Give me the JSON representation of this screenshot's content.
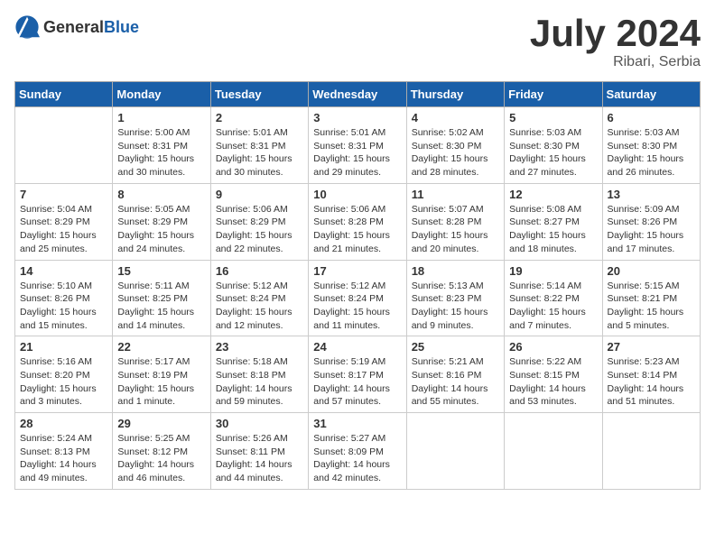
{
  "header": {
    "logo_general": "General",
    "logo_blue": "Blue",
    "month_year": "July 2024",
    "location": "Ribari, Serbia"
  },
  "weekdays": [
    "Sunday",
    "Monday",
    "Tuesday",
    "Wednesday",
    "Thursday",
    "Friday",
    "Saturday"
  ],
  "weeks": [
    [
      {
        "day": "",
        "info": ""
      },
      {
        "day": "1",
        "info": "Sunrise: 5:00 AM\nSunset: 8:31 PM\nDaylight: 15 hours\nand 30 minutes."
      },
      {
        "day": "2",
        "info": "Sunrise: 5:01 AM\nSunset: 8:31 PM\nDaylight: 15 hours\nand 30 minutes."
      },
      {
        "day": "3",
        "info": "Sunrise: 5:01 AM\nSunset: 8:31 PM\nDaylight: 15 hours\nand 29 minutes."
      },
      {
        "day": "4",
        "info": "Sunrise: 5:02 AM\nSunset: 8:30 PM\nDaylight: 15 hours\nand 28 minutes."
      },
      {
        "day": "5",
        "info": "Sunrise: 5:03 AM\nSunset: 8:30 PM\nDaylight: 15 hours\nand 27 minutes."
      },
      {
        "day": "6",
        "info": "Sunrise: 5:03 AM\nSunset: 8:30 PM\nDaylight: 15 hours\nand 26 minutes."
      }
    ],
    [
      {
        "day": "7",
        "info": "Sunrise: 5:04 AM\nSunset: 8:29 PM\nDaylight: 15 hours\nand 25 minutes."
      },
      {
        "day": "8",
        "info": "Sunrise: 5:05 AM\nSunset: 8:29 PM\nDaylight: 15 hours\nand 24 minutes."
      },
      {
        "day": "9",
        "info": "Sunrise: 5:06 AM\nSunset: 8:29 PM\nDaylight: 15 hours\nand 22 minutes."
      },
      {
        "day": "10",
        "info": "Sunrise: 5:06 AM\nSunset: 8:28 PM\nDaylight: 15 hours\nand 21 minutes."
      },
      {
        "day": "11",
        "info": "Sunrise: 5:07 AM\nSunset: 8:28 PM\nDaylight: 15 hours\nand 20 minutes."
      },
      {
        "day": "12",
        "info": "Sunrise: 5:08 AM\nSunset: 8:27 PM\nDaylight: 15 hours\nand 18 minutes."
      },
      {
        "day": "13",
        "info": "Sunrise: 5:09 AM\nSunset: 8:26 PM\nDaylight: 15 hours\nand 17 minutes."
      }
    ],
    [
      {
        "day": "14",
        "info": "Sunrise: 5:10 AM\nSunset: 8:26 PM\nDaylight: 15 hours\nand 15 minutes."
      },
      {
        "day": "15",
        "info": "Sunrise: 5:11 AM\nSunset: 8:25 PM\nDaylight: 15 hours\nand 14 minutes."
      },
      {
        "day": "16",
        "info": "Sunrise: 5:12 AM\nSunset: 8:24 PM\nDaylight: 15 hours\nand 12 minutes."
      },
      {
        "day": "17",
        "info": "Sunrise: 5:12 AM\nSunset: 8:24 PM\nDaylight: 15 hours\nand 11 minutes."
      },
      {
        "day": "18",
        "info": "Sunrise: 5:13 AM\nSunset: 8:23 PM\nDaylight: 15 hours\nand 9 minutes."
      },
      {
        "day": "19",
        "info": "Sunrise: 5:14 AM\nSunset: 8:22 PM\nDaylight: 15 hours\nand 7 minutes."
      },
      {
        "day": "20",
        "info": "Sunrise: 5:15 AM\nSunset: 8:21 PM\nDaylight: 15 hours\nand 5 minutes."
      }
    ],
    [
      {
        "day": "21",
        "info": "Sunrise: 5:16 AM\nSunset: 8:20 PM\nDaylight: 15 hours\nand 3 minutes."
      },
      {
        "day": "22",
        "info": "Sunrise: 5:17 AM\nSunset: 8:19 PM\nDaylight: 15 hours\nand 1 minute."
      },
      {
        "day": "23",
        "info": "Sunrise: 5:18 AM\nSunset: 8:18 PM\nDaylight: 14 hours\nand 59 minutes."
      },
      {
        "day": "24",
        "info": "Sunrise: 5:19 AM\nSunset: 8:17 PM\nDaylight: 14 hours\nand 57 minutes."
      },
      {
        "day": "25",
        "info": "Sunrise: 5:21 AM\nSunset: 8:16 PM\nDaylight: 14 hours\nand 55 minutes."
      },
      {
        "day": "26",
        "info": "Sunrise: 5:22 AM\nSunset: 8:15 PM\nDaylight: 14 hours\nand 53 minutes."
      },
      {
        "day": "27",
        "info": "Sunrise: 5:23 AM\nSunset: 8:14 PM\nDaylight: 14 hours\nand 51 minutes."
      }
    ],
    [
      {
        "day": "28",
        "info": "Sunrise: 5:24 AM\nSunset: 8:13 PM\nDaylight: 14 hours\nand 49 minutes."
      },
      {
        "day": "29",
        "info": "Sunrise: 5:25 AM\nSunset: 8:12 PM\nDaylight: 14 hours\nand 46 minutes."
      },
      {
        "day": "30",
        "info": "Sunrise: 5:26 AM\nSunset: 8:11 PM\nDaylight: 14 hours\nand 44 minutes."
      },
      {
        "day": "31",
        "info": "Sunrise: 5:27 AM\nSunset: 8:09 PM\nDaylight: 14 hours\nand 42 minutes."
      },
      {
        "day": "",
        "info": ""
      },
      {
        "day": "",
        "info": ""
      },
      {
        "day": "",
        "info": ""
      }
    ]
  ]
}
